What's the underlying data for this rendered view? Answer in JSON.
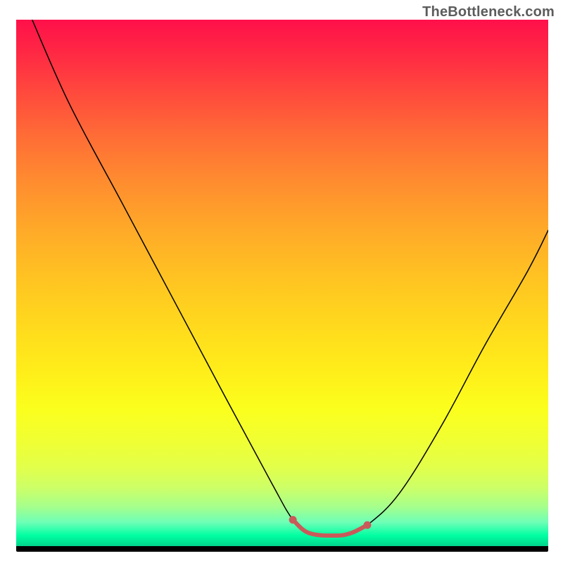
{
  "watermark": "TheBottleneck.com",
  "chart_data": {
    "type": "line",
    "title": "",
    "xlabel": "",
    "ylabel": "",
    "xlim": [
      0,
      100
    ],
    "ylim": [
      0,
      100
    ],
    "series": [
      {
        "name": "curve",
        "x": [
          3,
          10,
          20,
          30,
          40,
          48,
          52,
          55,
          60,
          63,
          66,
          72,
          80,
          88,
          96,
          100
        ],
        "y": [
          100,
          84,
          65,
          46,
          27,
          12,
          5,
          2.5,
          2,
          2.5,
          4,
          10,
          23,
          38,
          52,
          60
        ]
      }
    ],
    "highlight_range_x": [
      52,
      66
    ],
    "background_gradient": {
      "top": "#ff104a",
      "bottom": "#00d48c"
    }
  }
}
